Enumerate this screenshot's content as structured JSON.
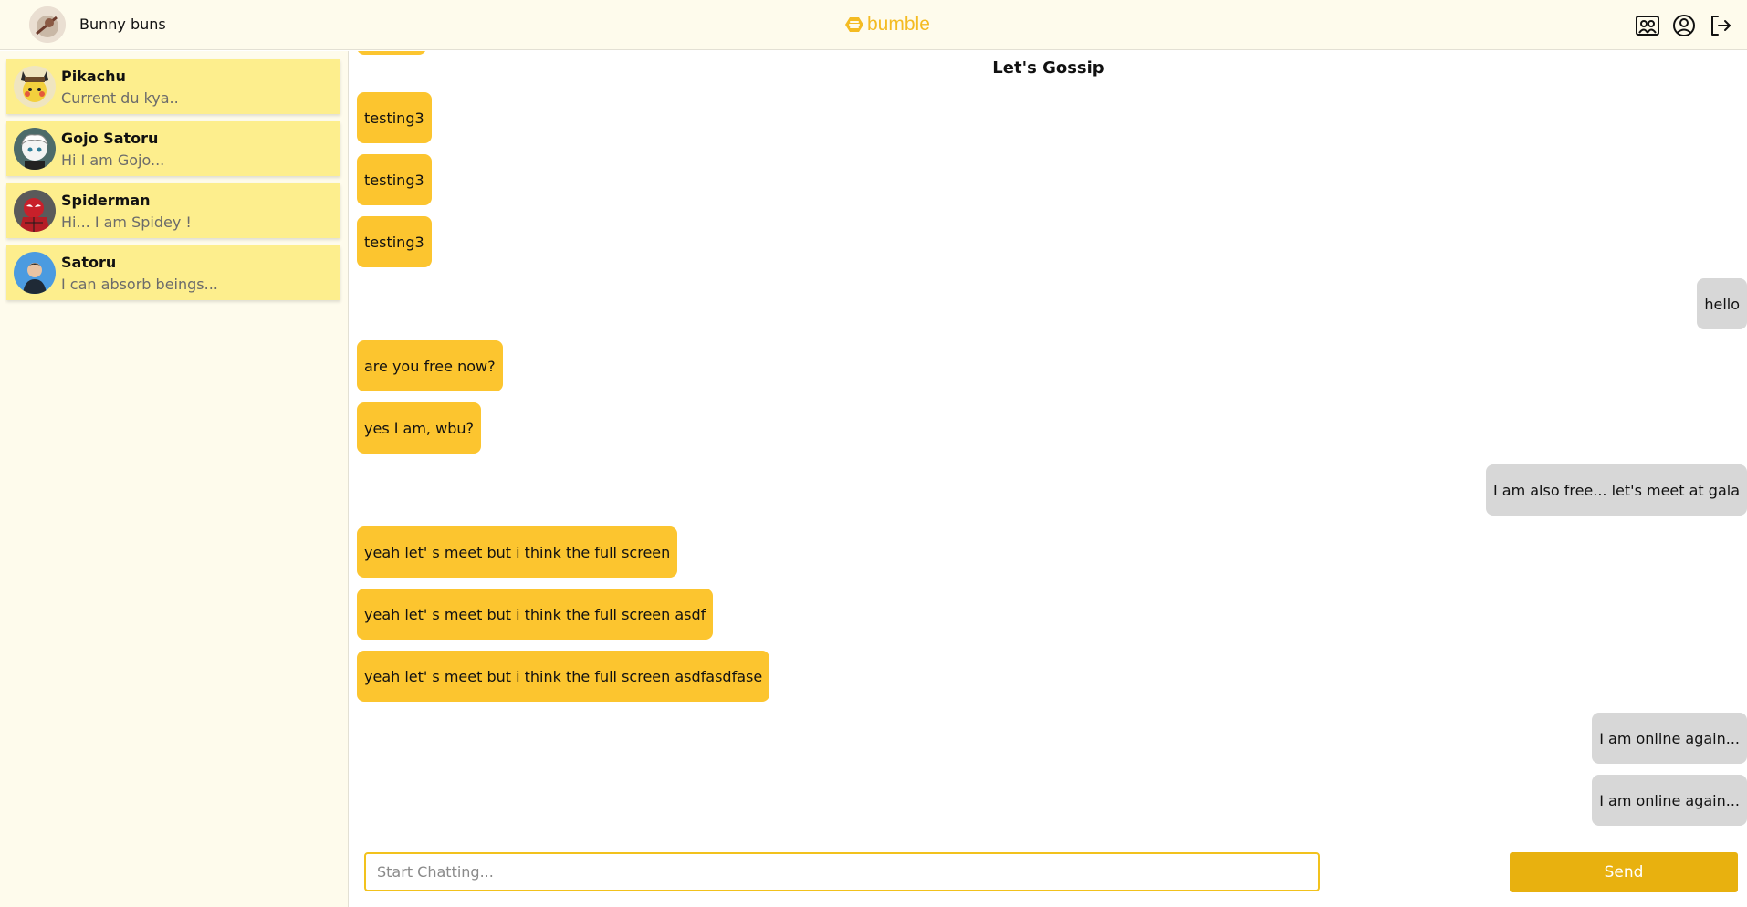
{
  "header": {
    "username": "Bunny buns",
    "logo_text": "bumble",
    "icons": [
      "friends-icon",
      "profile-icon",
      "logout-icon"
    ]
  },
  "sidebar": {
    "contacts": [
      {
        "name": "Pikachu",
        "preview": "Current du kya..",
        "avatar": "pikachu-avatar"
      },
      {
        "name": "Gojo Satoru",
        "preview": "Hi I am Gojo...",
        "avatar": "gojo-avatar"
      },
      {
        "name": "Spiderman",
        "preview": "Hi... I am Spidey !",
        "avatar": "spiderman-avatar"
      },
      {
        "name": "Satoru",
        "preview": "I can absorb beings...",
        "avatar": "satoru-avatar"
      }
    ]
  },
  "chat": {
    "title": "Let's Gossip",
    "messages": [
      {
        "text": "testing3",
        "from": "them"
      },
      {
        "text": "testing3",
        "from": "them"
      },
      {
        "text": "testing3",
        "from": "them"
      },
      {
        "text": "hello",
        "from": "me"
      },
      {
        "text": "are you free now?",
        "from": "them"
      },
      {
        "text": "yes I am, wbu?",
        "from": "them"
      },
      {
        "text": "I am also free... let's meet at gala",
        "from": "me"
      },
      {
        "text": "yeah let' s meet but i think the full screen",
        "from": "them"
      },
      {
        "text": "yeah let' s meet but i think the full screen asdf",
        "from": "them"
      },
      {
        "text": "yeah let' s meet but i think the full screen asdfasdfase",
        "from": "them"
      },
      {
        "text": "I am online again...",
        "from": "me"
      },
      {
        "text": "I am online again...",
        "from": "me"
      }
    ],
    "input_placeholder": "Start Chatting...",
    "input_value": "",
    "send_label": "Send"
  },
  "colors": {
    "brand": "#f4bb22",
    "their_bubble": "#fcc52f",
    "my_bubble": "#d7d7d7",
    "contact_card": "#fdee8d",
    "sidebar_bg": "#fefbec",
    "send_button": "#e8b10f"
  }
}
